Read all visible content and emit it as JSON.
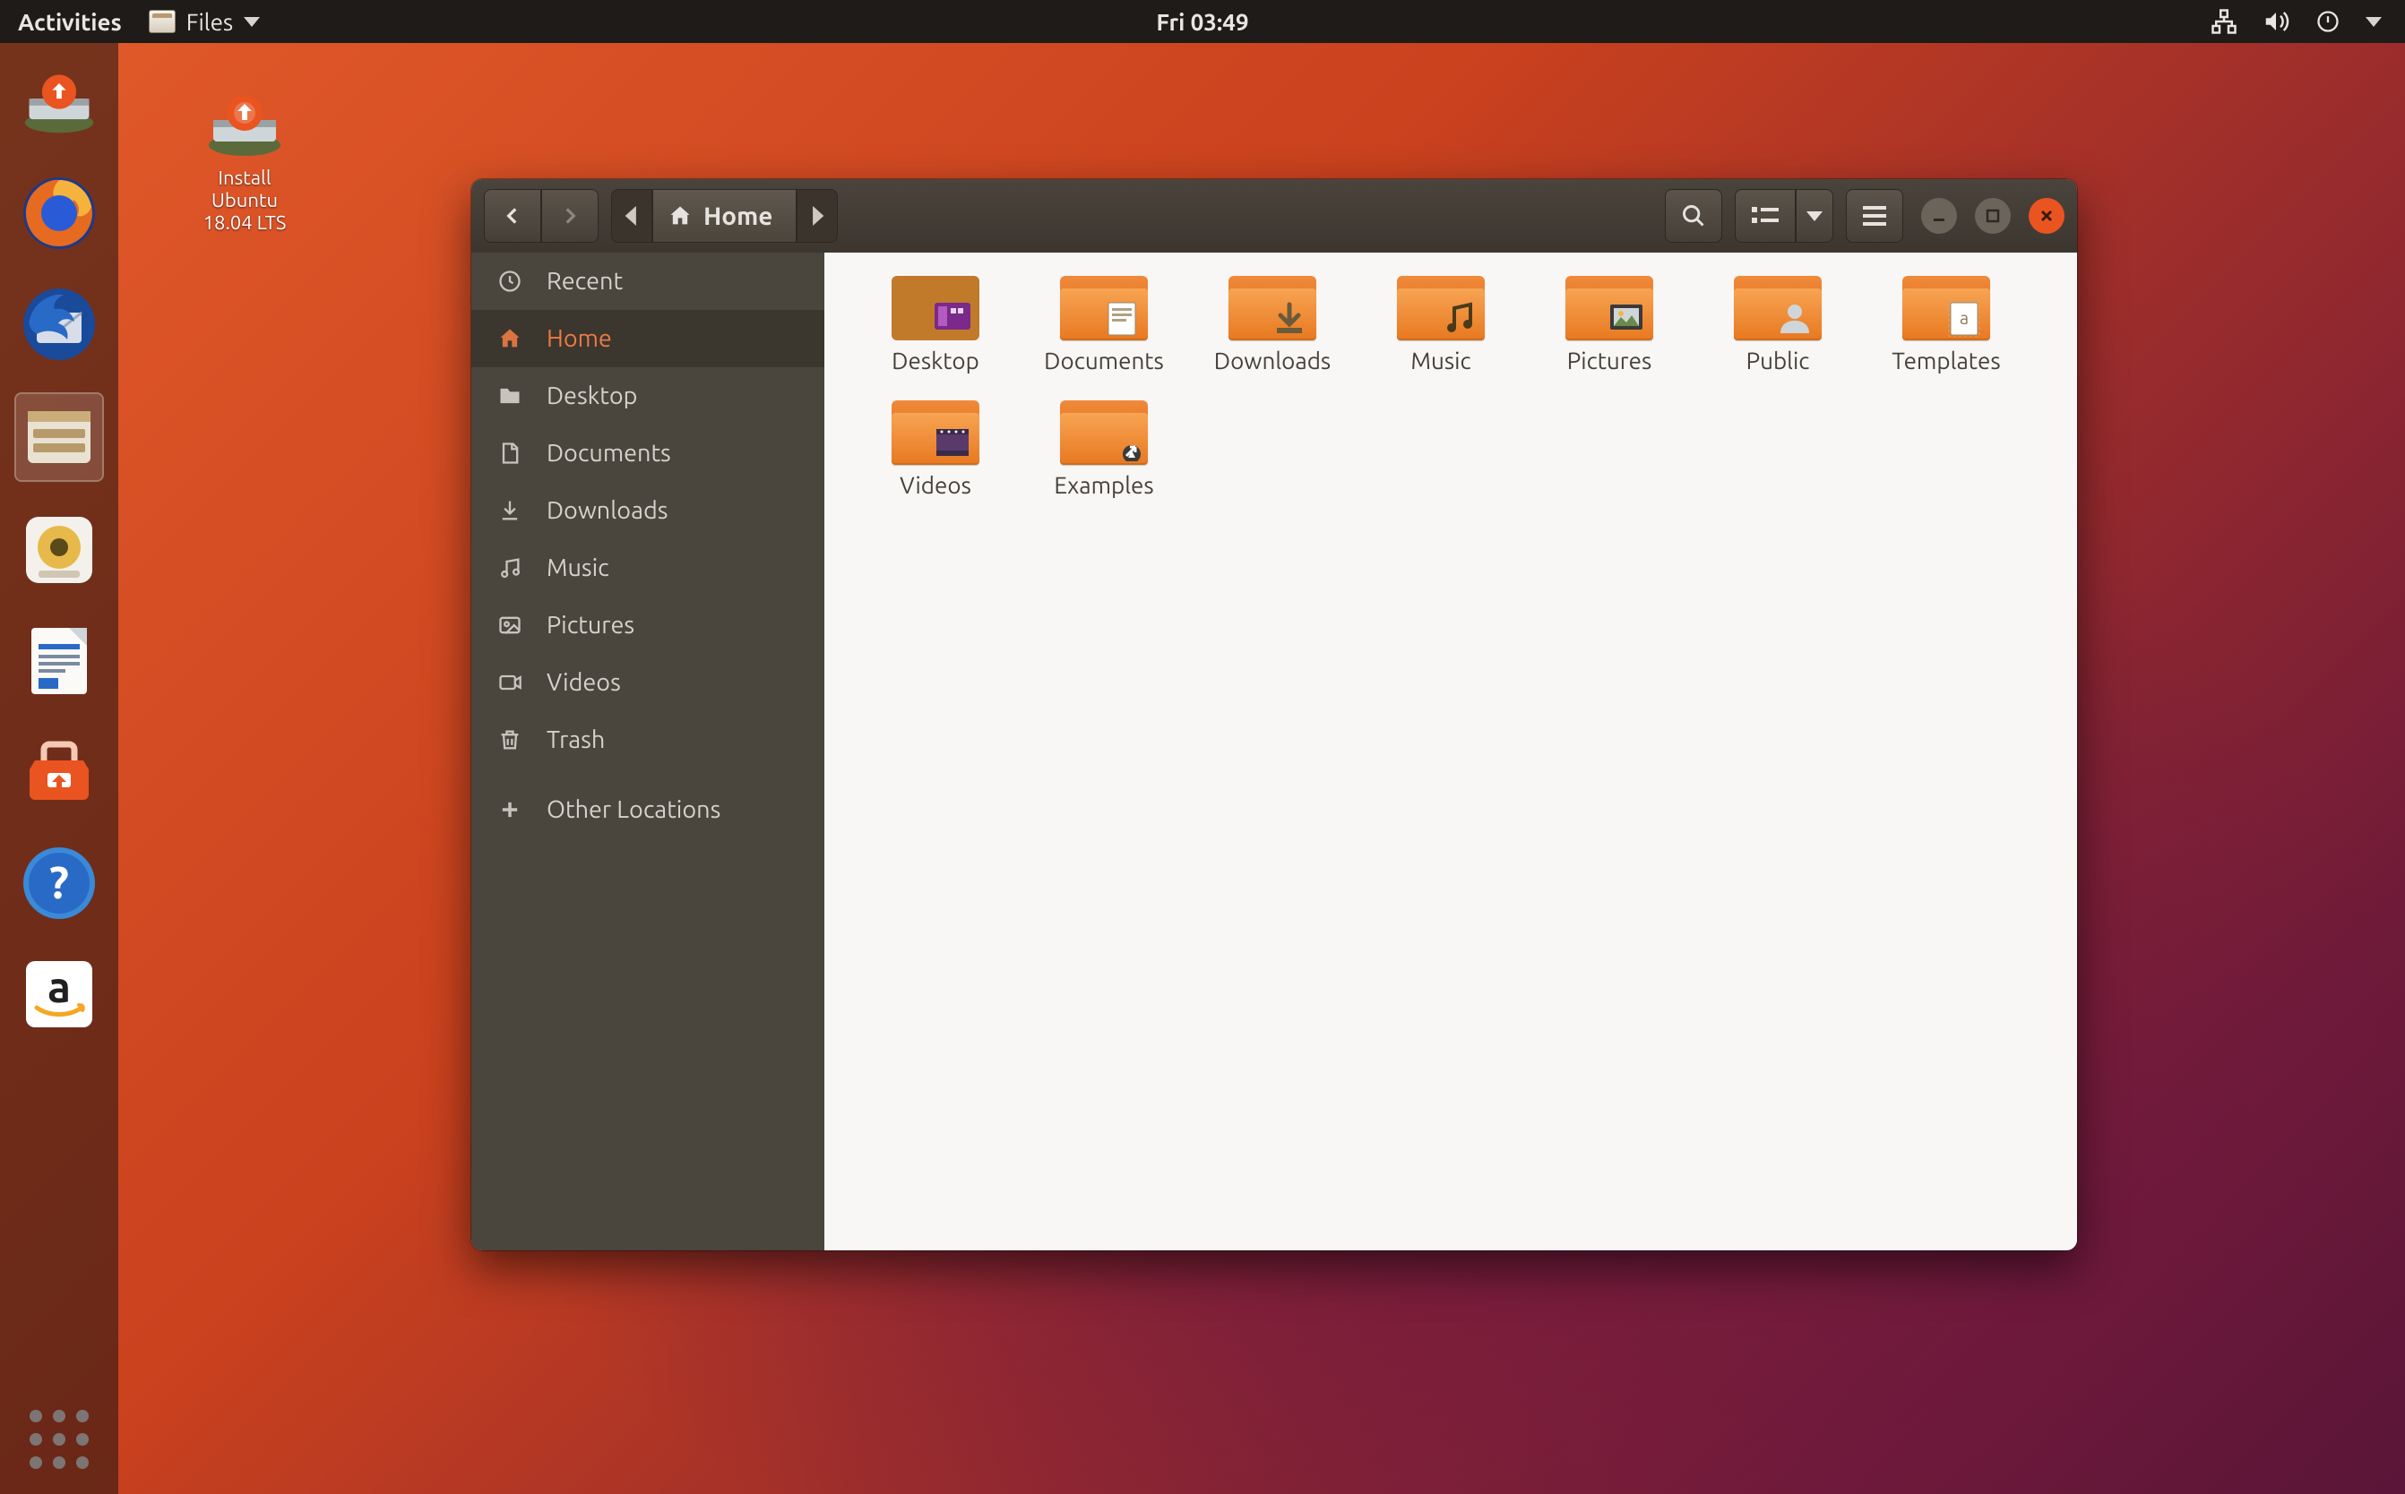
{
  "topbar": {
    "activities": "Activities",
    "app_menu": "Files",
    "clock": "Fri 03:49"
  },
  "desktop_icon": {
    "line1": "Install",
    "line2": "Ubuntu",
    "line3": "18.04 LTS"
  },
  "dock": [
    {
      "name": "install-ubuntu",
      "tip": "Install Ubuntu"
    },
    {
      "name": "firefox",
      "tip": "Firefox"
    },
    {
      "name": "thunderbird",
      "tip": "Thunderbird"
    },
    {
      "name": "files",
      "tip": "Files",
      "active": true
    },
    {
      "name": "rhythmbox",
      "tip": "Rhythmbox"
    },
    {
      "name": "libreoffice-writer",
      "tip": "LibreOffice Writer"
    },
    {
      "name": "ubuntu-software",
      "tip": "Ubuntu Software"
    },
    {
      "name": "help",
      "tip": "Help"
    },
    {
      "name": "amazon",
      "tip": "Amazon"
    }
  ],
  "window": {
    "path_label": "Home",
    "sidebar": [
      {
        "icon": "clock",
        "label": "Recent"
      },
      {
        "icon": "home",
        "label": "Home",
        "active": true
      },
      {
        "icon": "folder",
        "label": "Desktop"
      },
      {
        "icon": "document",
        "label": "Documents"
      },
      {
        "icon": "download",
        "label": "Downloads"
      },
      {
        "icon": "music",
        "label": "Music"
      },
      {
        "icon": "pictures",
        "label": "Pictures"
      },
      {
        "icon": "videos",
        "label": "Videos"
      },
      {
        "icon": "trash",
        "label": "Trash"
      },
      {
        "icon": "plus",
        "label": "Other Locations",
        "gap": true
      }
    ],
    "items": [
      {
        "label": "Desktop",
        "overlay": "desktop"
      },
      {
        "label": "Documents",
        "overlay": "doc"
      },
      {
        "label": "Downloads",
        "overlay": "down"
      },
      {
        "label": "Music",
        "overlay": "music"
      },
      {
        "label": "Pictures",
        "overlay": "pic"
      },
      {
        "label": "Public",
        "overlay": "public"
      },
      {
        "label": "Templates",
        "overlay": "tmpl"
      },
      {
        "label": "Videos",
        "overlay": "video"
      },
      {
        "label": "Examples",
        "overlay": "link"
      }
    ]
  }
}
